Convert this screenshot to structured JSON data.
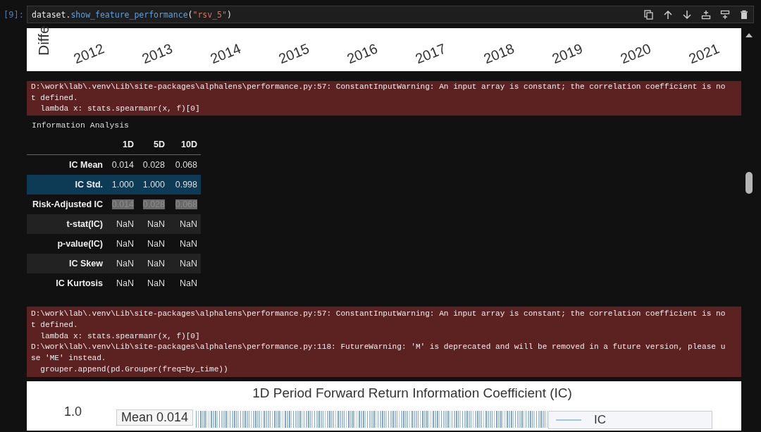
{
  "cell": {
    "prompt": "[9]:",
    "code": [
      {
        "kind": "plain",
        "text": "dataset."
      },
      {
        "kind": "func",
        "text": "show_feature_performance"
      },
      {
        "kind": "plain",
        "text": "("
      },
      {
        "kind": "string",
        "text": "\"rsv_5\""
      },
      {
        "kind": "plain",
        "text": ")"
      }
    ]
  },
  "top_chart": {
    "ylabel": "Diffe",
    "xtick_labels": [
      "2012",
      "2013",
      "2014",
      "2015",
      "2016",
      "2017",
      "2018",
      "2019",
      "2020",
      "2021"
    ]
  },
  "warning_1": [
    "D:\\work\\lab\\.venv\\Lib\\site-packages\\alphalens\\performance.py:57: ConstantInputWarning: An input array is constant; the correlation coefficient is no",
    "t defined.",
    "  lambda x: stats.spearmanr(x, f)[0]"
  ],
  "info_title": "Information Analysis",
  "table": {
    "columns": [
      "1D",
      "5D",
      "10D"
    ],
    "rows": [
      {
        "label": "IC Mean",
        "values": [
          "0.014",
          "0.028",
          "0.068"
        ],
        "selected": false,
        "highlighted": false
      },
      {
        "label": "IC Std.",
        "values": [
          "1.000",
          "1.000",
          "0.998"
        ],
        "selected": true,
        "highlighted": false
      },
      {
        "label": "Risk-Adjusted IC",
        "values": [
          "0.014",
          "0.028",
          "0.068"
        ],
        "selected": false,
        "highlighted": true
      },
      {
        "label": "t-stat(IC)",
        "values": [
          "NaN",
          "NaN",
          "NaN"
        ],
        "selected": false,
        "highlighted": false
      },
      {
        "label": "p-value(IC)",
        "values": [
          "NaN",
          "NaN",
          "NaN"
        ],
        "selected": false,
        "highlighted": false
      },
      {
        "label": "IC Skew",
        "values": [
          "NaN",
          "NaN",
          "NaN"
        ],
        "selected": false,
        "highlighted": false
      },
      {
        "label": "IC Kurtosis",
        "values": [
          "NaN",
          "NaN",
          "NaN"
        ],
        "selected": false,
        "highlighted": false
      }
    ]
  },
  "warning_2": [
    "D:\\work\\lab\\.venv\\Lib\\site-packages\\alphalens\\performance.py:57: ConstantInputWarning: An input array is constant; the correlation coefficient is no",
    "t defined.",
    "  lambda x: stats.spearmanr(x, f)[0]",
    "D:\\work\\lab\\.venv\\Lib\\site-packages\\alphalens\\performance.py:118: FutureWarning: 'M' is deprecated and will be removed in a future version, please u",
    "se 'ME' instead.",
    "  grouper.append(pd.Grouper(freq=by_time))"
  ],
  "bottom_chart": {
    "title": "1D Period Forward Return Information Coefficient (IC)",
    "ytick": "1.0",
    "stats_label": "Mean 0.014",
    "legend_label": "IC"
  }
}
